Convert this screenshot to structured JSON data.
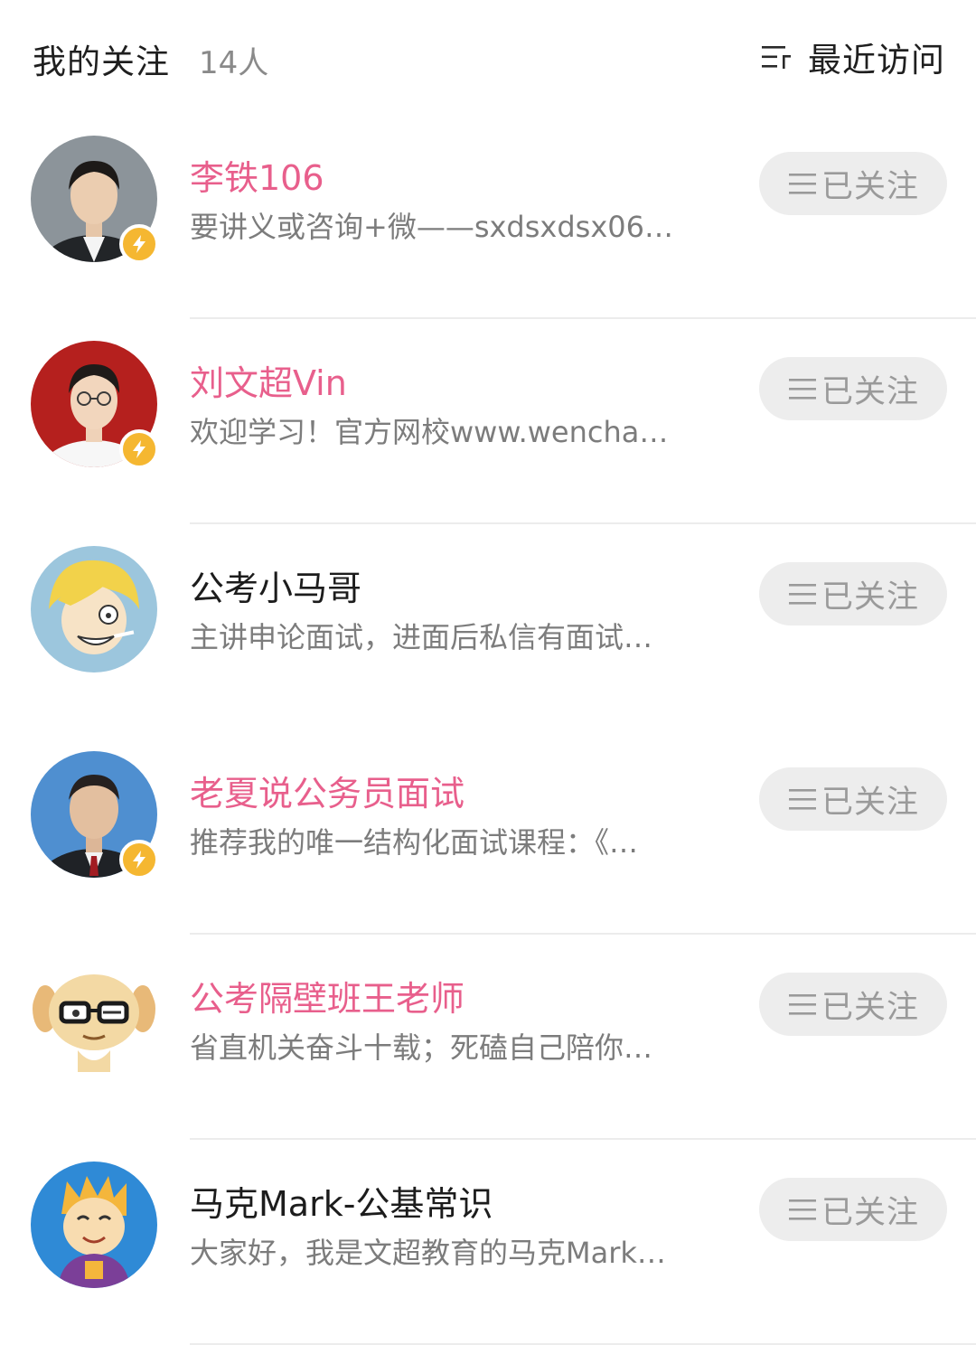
{
  "header": {
    "title": "我的关注",
    "count": "14人",
    "sort_label": "最近访问"
  },
  "colors": {
    "highlight_name": "#e85f8c",
    "badge": "#f5b731",
    "button_bg": "#ededed"
  },
  "follow_rows": [
    {
      "name": "李铁106",
      "desc": "要讲义或咨询+微——sxdsxdsx06…",
      "button": "已关注"
    },
    {
      "name": "刘文超Vin",
      "desc": "欢迎学习！官方网校www.wencha…",
      "button": "已关注"
    },
    {
      "name": "公考小马哥",
      "desc": "主讲申论面试，进面后私信有面试…",
      "button": "已关注"
    },
    {
      "name": "老夏说公务员面试",
      "desc": "推荐我的唯一结构化面试课程：《…",
      "button": "已关注"
    },
    {
      "name": "公考隔壁班王老师",
      "desc": "省直机关奋斗十载；死磕自己陪你…",
      "button": "已关注"
    },
    {
      "name": "马克Mark-公基常识",
      "desc": "大家好，我是文超教育的马克Mark…",
      "button": "已关注"
    }
  ]
}
